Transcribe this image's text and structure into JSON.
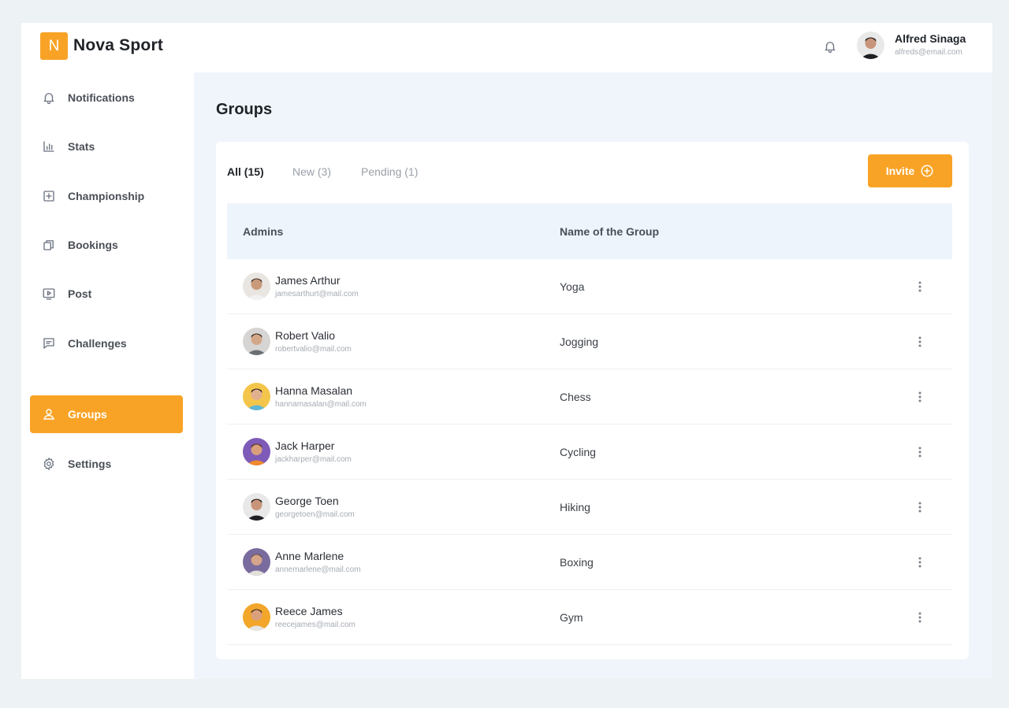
{
  "header": {
    "logo_letter": "N",
    "brand": "Nova Sport",
    "user": {
      "name": "Alfred Sinaga",
      "email": "alfreds@email.com"
    }
  },
  "sidebar": {
    "items": [
      {
        "label": "Notifications",
        "icon": "bell-icon",
        "active": false
      },
      {
        "label": "Stats",
        "icon": "bar-chart-icon",
        "active": false
      },
      {
        "label": "Championship",
        "icon": "trophy-box-icon",
        "active": false
      },
      {
        "label": "Bookings",
        "icon": "copy-stack-icon",
        "active": false
      },
      {
        "label": "Post",
        "icon": "play-screen-icon",
        "active": false
      },
      {
        "label": "Challenges",
        "icon": "message-square-icon",
        "active": false
      },
      {
        "label": "Groups",
        "icon": "user-icon",
        "active": true
      },
      {
        "label": "Settings",
        "icon": "gear-icon",
        "active": false
      }
    ]
  },
  "main": {
    "title": "Groups",
    "tabs": [
      {
        "label": "All (15)",
        "active": true
      },
      {
        "label": "New (3)",
        "active": false
      },
      {
        "label": "Pending (1)",
        "active": false
      }
    ],
    "invite_label": "Invite",
    "table": {
      "columns": [
        "Admins",
        "Name of the Group"
      ],
      "rows": [
        {
          "name": "James Arthur",
          "email": "jamesarthurt@mail.com",
          "group": "Yoga",
          "avatar_bg": "#e9e6e1",
          "shirt": "#f2f2f2",
          "skin": "#c99a7a",
          "hair": "#4a3a30"
        },
        {
          "name": "Robert Valio",
          "email": "robertvalio@mail.com",
          "group": "Jogging",
          "avatar_bg": "#d7d5d3",
          "shirt": "#6b6f75",
          "skin": "#d3a889",
          "hair": "#3d3128"
        },
        {
          "name": "Hanna Masalan",
          "email": "hannamasalan@mail.com",
          "group": "Chess",
          "avatar_bg": "#f3c64b",
          "shirt": "#5fb6d8",
          "skin": "#e0b08f",
          "hair": "#2f241d"
        },
        {
          "name": "Jack Harper",
          "email": "jackharper@mail.com",
          "group": "Cycling",
          "avatar_bg": "#7e5bb8",
          "shirt": "#f08a2e",
          "skin": "#d9a07b",
          "hair": "#5a3a22"
        },
        {
          "name": "George Toen",
          "email": "georgetoen@mail.com",
          "group": "Hiking",
          "avatar_bg": "#e8e8e8",
          "shirt": "#1e1f22",
          "skin": "#c9957a",
          "hair": "#1f1a17"
        },
        {
          "name": "Anne Marlene",
          "email": "annemarlene@mail.com",
          "group": "Boxing",
          "avatar_bg": "#7a6b9e",
          "shirt": "#e4e0da",
          "skin": "#d6a48a",
          "hair": "#6b5a4a"
        },
        {
          "name": "Reece James",
          "email": "reecejames@mail.com",
          "group": "Gym",
          "avatar_bg": "#f2a62a",
          "shirt": "#e5e5e5",
          "skin": "#d9a07b",
          "hair": "#4a321f"
        }
      ]
    }
  },
  "colors": {
    "accent": "#f9a326",
    "page_bg": "#edf2f5",
    "main_bg": "#f0f5fb"
  }
}
